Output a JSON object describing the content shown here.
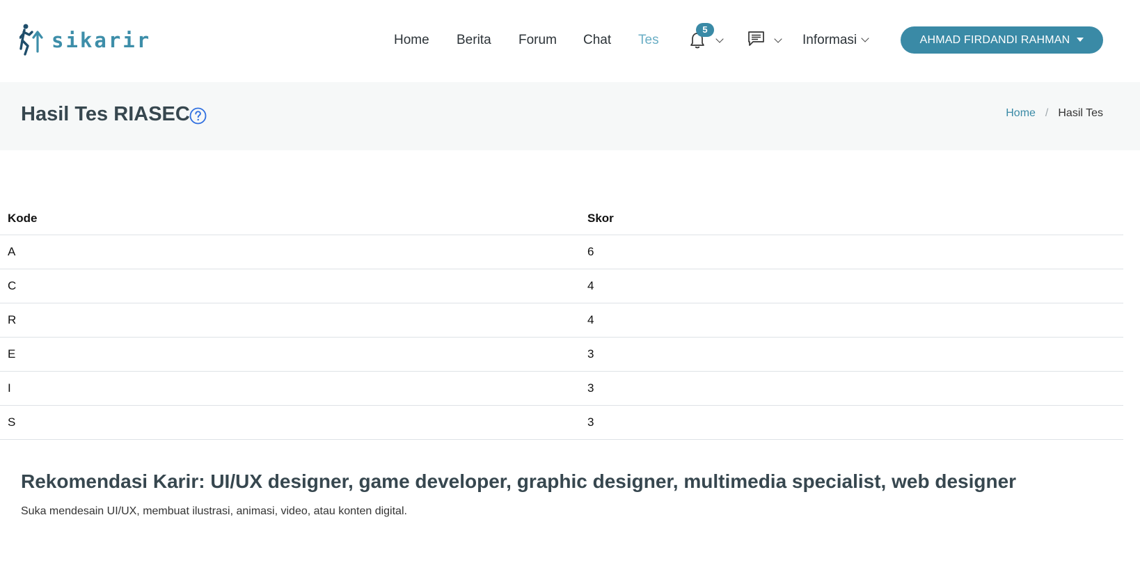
{
  "app": {
    "logo_text": "sikarir"
  },
  "nav": {
    "home": "Home",
    "berita": "Berita",
    "forum": "Forum",
    "chat": "Chat",
    "tes": "Tes",
    "notifications_count": "5",
    "informasi": "Informasi",
    "user_name": "AHMAD FIRDANDI RAHMAN"
  },
  "page": {
    "title": "Hasil Tes RIASEC",
    "breadcrumb": {
      "home": "Home",
      "separator": "/",
      "current": "Hasil Tes"
    }
  },
  "table": {
    "headers": [
      "Kode",
      "Skor"
    ],
    "rows": [
      [
        "A",
        "6"
      ],
      [
        "C",
        "4"
      ],
      [
        "R",
        "4"
      ],
      [
        "E",
        "3"
      ],
      [
        "I",
        "3"
      ],
      [
        "S",
        "3"
      ]
    ]
  },
  "recommendation": {
    "label": "Rekomendasi Karir: ",
    "careers": "UI/UX designer, game developer, graphic designer, multimedia specialist, web designer",
    "description": "Suka mendesain UI/UX, membuat ilustrasi, animasi, video, atau konten digital."
  },
  "colors": {
    "brand": "#3a8aa6",
    "active_nav": "#6aaec5",
    "band_bg": "#f6f8f8",
    "title": "#37474f"
  },
  "icons": [
    "runner-logo-icon",
    "bell-icon",
    "chat-icon",
    "question-circle-icon",
    "chevron-down-icon",
    "caret-down-icon"
  ]
}
